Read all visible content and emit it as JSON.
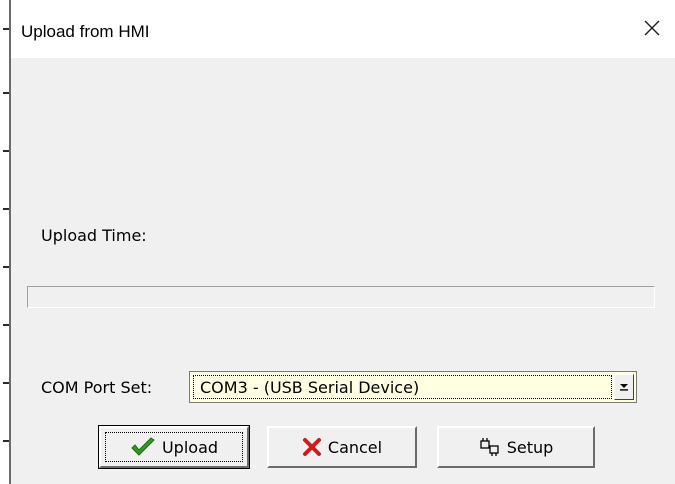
{
  "window": {
    "title": "Upload from HMI",
    "close_icon": "close-icon"
  },
  "upload": {
    "time_label": "Upload Time:",
    "progress_percent": 0
  },
  "com_port": {
    "label": "COM Port Set:",
    "selected_value": "COM3 - (USB Serial Device)",
    "field_color": "#ffffe1"
  },
  "buttons": {
    "upload_label": "Upload",
    "upload_icon": "checkmark-icon",
    "cancel_label": "Cancel",
    "cancel_icon": "red-x-icon",
    "setup_label": "Setup",
    "setup_icon": "connector-icon"
  }
}
